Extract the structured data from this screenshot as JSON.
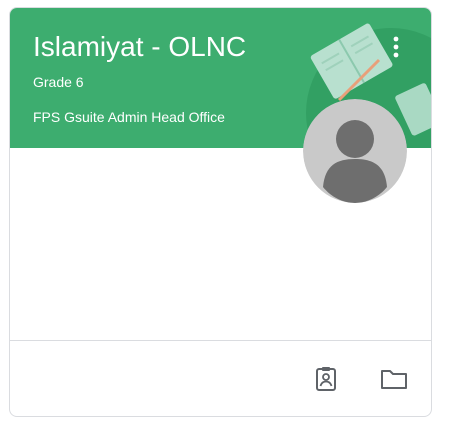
{
  "class_card": {
    "title": "Islamiyat - OLNC",
    "section": "Grade 6",
    "owner": "FPS Gsuite Admin Head Office",
    "theme_color": "#3dad6f",
    "menu_icon": "more-vert-icon",
    "avatar_icon": "default-avatar-icon",
    "illustration": "books-illustration",
    "footer_actions": [
      {
        "name": "gradebook",
        "icon": "assignment-ind-icon"
      },
      {
        "name": "class-drive-folder",
        "icon": "folder-icon"
      }
    ]
  }
}
